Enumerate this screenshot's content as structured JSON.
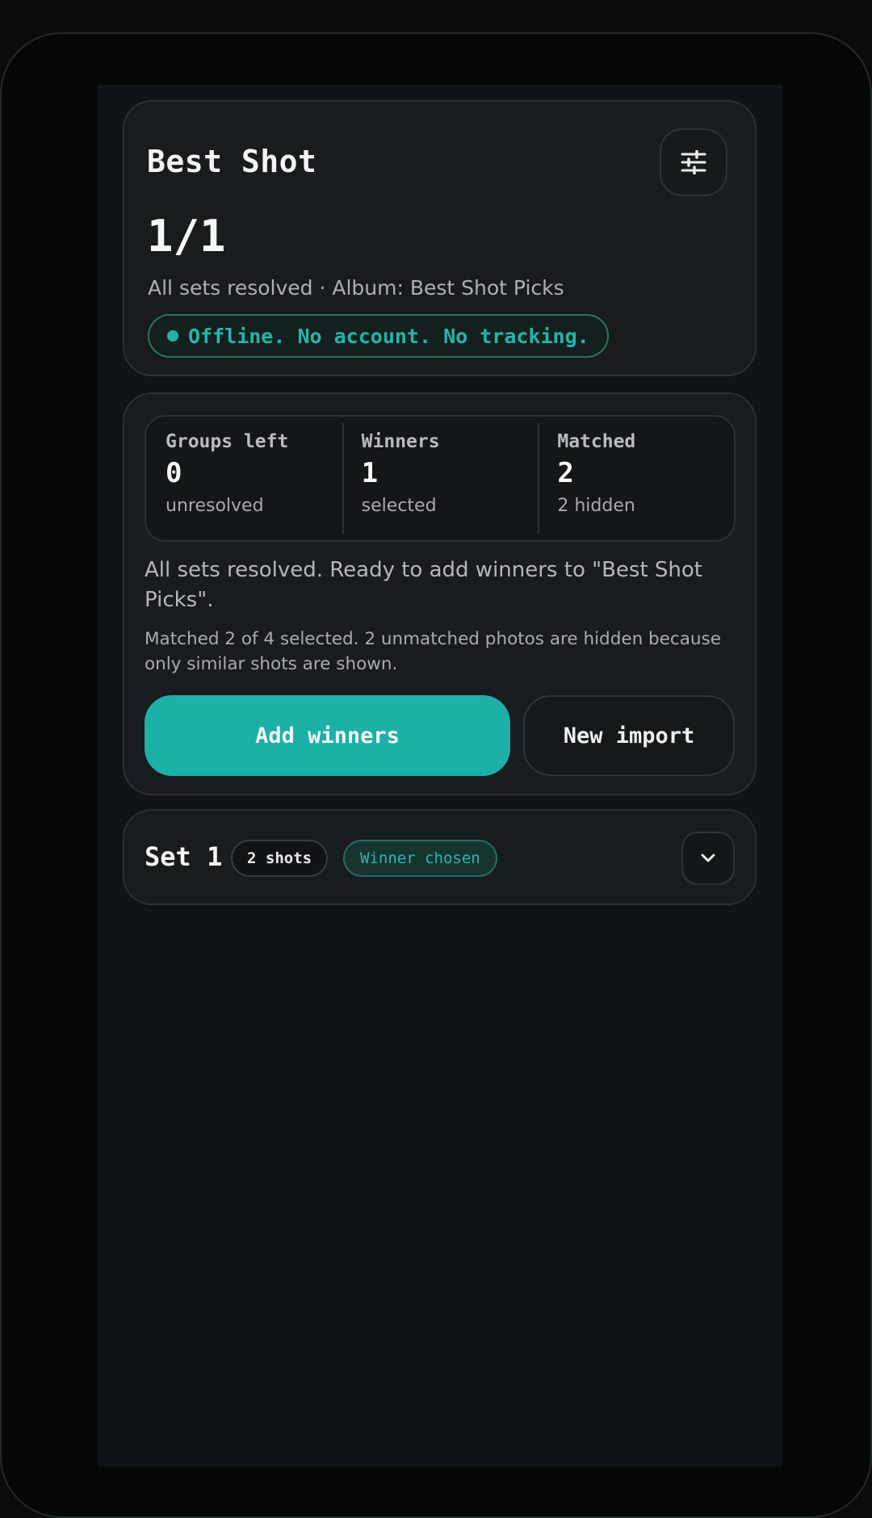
{
  "header": {
    "title": "Best Shot",
    "progress": "1/1",
    "summary": "All sets resolved · Album: Best Shot Picks",
    "privacy_badge": "Offline. No account. No tracking.",
    "settings_icon": "sliders-icon"
  },
  "stats": [
    {
      "label": "Groups left",
      "value": "0",
      "sub": "unresolved"
    },
    {
      "label": "Winners",
      "value": "1",
      "sub": "selected"
    },
    {
      "label": "Matched",
      "value": "2",
      "sub": "2 hidden"
    }
  ],
  "status": {
    "ready_message": "All sets resolved. Ready to add winners to \"Best Shot Picks\".",
    "matched_message": "Matched 2 of 4 selected. 2 unmatched photos are hidden because only similar shots are shown."
  },
  "actions": {
    "primary_label": "Add winners",
    "secondary_label": "New import"
  },
  "sets": [
    {
      "title": "Set 1",
      "shots_badge": "2 shots",
      "status_badge": "Winner chosen",
      "expand_icon": "chevron-down-icon"
    }
  ],
  "colors": {
    "accent": "#1cb0a7",
    "background": "#0f1417",
    "card": "#171c20"
  }
}
